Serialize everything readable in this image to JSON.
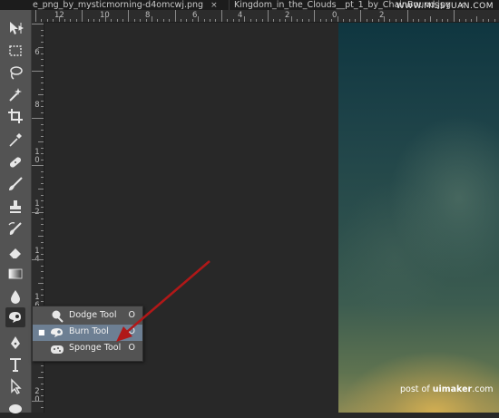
{
  "tabs": [
    {
      "label": "e_png_by_mysticmorning-d4omcwj.png",
      "close": "×"
    },
    {
      "label": "Kingdom_in_the_Clouds__pt_1_by_ChainBound.jpg",
      "close": "×"
    }
  ],
  "watermark_top": "WWW.MISSYUAN.COM",
  "watermark_bottom": {
    "prefix": "post of ",
    "brand": "uimaker",
    "suffix": ".com"
  },
  "horizontal_ruler": [
    "12",
    "10",
    "8",
    "6",
    "4",
    "2",
    "0",
    "2"
  ],
  "vertical_ruler": [
    "6",
    "8",
    "1 0",
    "1 2",
    "1 4",
    "1 6",
    "1 8",
    "2 0"
  ],
  "tools": [
    {
      "name": "move-tool-icon"
    },
    {
      "name": "marquee-tool-icon"
    },
    {
      "name": "lasso-tool-icon"
    },
    {
      "name": "magic-wand-tool-icon"
    },
    {
      "name": "crop-tool-icon"
    },
    {
      "name": "eyedropper-tool-icon"
    },
    {
      "name": "healing-brush-tool-icon"
    },
    {
      "name": "brush-tool-icon"
    },
    {
      "name": "clone-stamp-tool-icon"
    },
    {
      "name": "history-brush-tool-icon"
    },
    {
      "name": "eraser-tool-icon"
    },
    {
      "name": "gradient-tool-icon"
    },
    {
      "name": "blur-tool-icon"
    },
    {
      "name": "burn-tool-icon"
    },
    {
      "name": "pen-tool-icon"
    },
    {
      "name": "type-tool-icon"
    },
    {
      "name": "path-selection-tool-icon"
    },
    {
      "name": "ellipse-tool-icon"
    }
  ],
  "flyout": {
    "items": [
      {
        "label": "Dodge Tool",
        "shortcut": "O",
        "icon": "dodge-icon",
        "selected": false
      },
      {
        "label": "Burn Tool",
        "shortcut": "O",
        "icon": "burn-icon",
        "selected": true
      },
      {
        "label": "Sponge Tool",
        "shortcut": "O",
        "icon": "sponge-icon",
        "selected": false
      }
    ]
  },
  "colors": {
    "arrow": "#b01818",
    "selection": "#6d7f93",
    "panel": "#535353"
  }
}
